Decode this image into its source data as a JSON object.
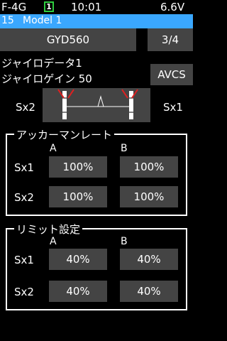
{
  "status": {
    "model_code": "F-4G",
    "badge": "1",
    "time": "10:01",
    "voltage": "6.6V"
  },
  "model": {
    "number": "15",
    "name": "Model 1"
  },
  "header": {
    "title_button": "GYD560",
    "page_button": "3/4"
  },
  "gyro": {
    "data_label": "ジャイロデータ1",
    "gain_label": "ジャイロゲイン 50",
    "mode_button": "AVCS",
    "left_label": "Sx2",
    "right_label": "Sx1"
  },
  "anchor": {
    "title": "アッカーマンレート",
    "col_a": "A",
    "col_b": "B",
    "rows": [
      {
        "label": "Sx1",
        "a": "100%",
        "b": "100%"
      },
      {
        "label": "Sx2",
        "a": "100%",
        "b": "100%"
      }
    ]
  },
  "limit": {
    "title": "リミット設定",
    "col_a": "A",
    "col_b": "B",
    "rows": [
      {
        "label": "Sx1",
        "a": "40%",
        "b": "40%"
      },
      {
        "label": "Sx2",
        "a": "40%",
        "b": "40%"
      }
    ]
  },
  "colors": {
    "accent": "#3aa7ff",
    "badge_border": "#2ecc40",
    "button": "#444444",
    "marker": "#e02020"
  }
}
